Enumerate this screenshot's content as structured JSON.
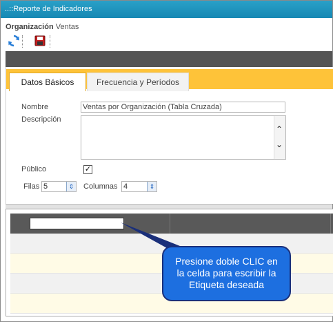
{
  "window": {
    "title": "..::Reporte de Indicadores"
  },
  "org": {
    "label": "Organización",
    "value": "Ventas"
  },
  "toolbar": {
    "refresh_icon": "refresh-icon",
    "save_icon": "save-icon"
  },
  "tabs": [
    {
      "label": "Datos Básicos",
      "active": true
    },
    {
      "label": "Frecuencia y Períodos",
      "active": false
    }
  ],
  "form": {
    "nombre_label": "Nombre",
    "nombre_value": "Ventas por Organización (Tabla Cruzada)",
    "descripcion_label": "Descripción",
    "descripcion_value": "",
    "publico_label": "Público",
    "publico_checked": true,
    "filas_label": "Filas",
    "filas_value": "5",
    "columnas_label": "Columnas",
    "columnas_value": "4"
  },
  "callout": {
    "line1": "Presione doble CLIC en",
    "line2": "la celda para escribir la",
    "line3": "Etiqueta deseada"
  },
  "colors": {
    "title_bar": "#1688b3",
    "tab_strip": "#fec339",
    "callout_bg": "#1d6fe0",
    "grid_header": "#595959"
  }
}
